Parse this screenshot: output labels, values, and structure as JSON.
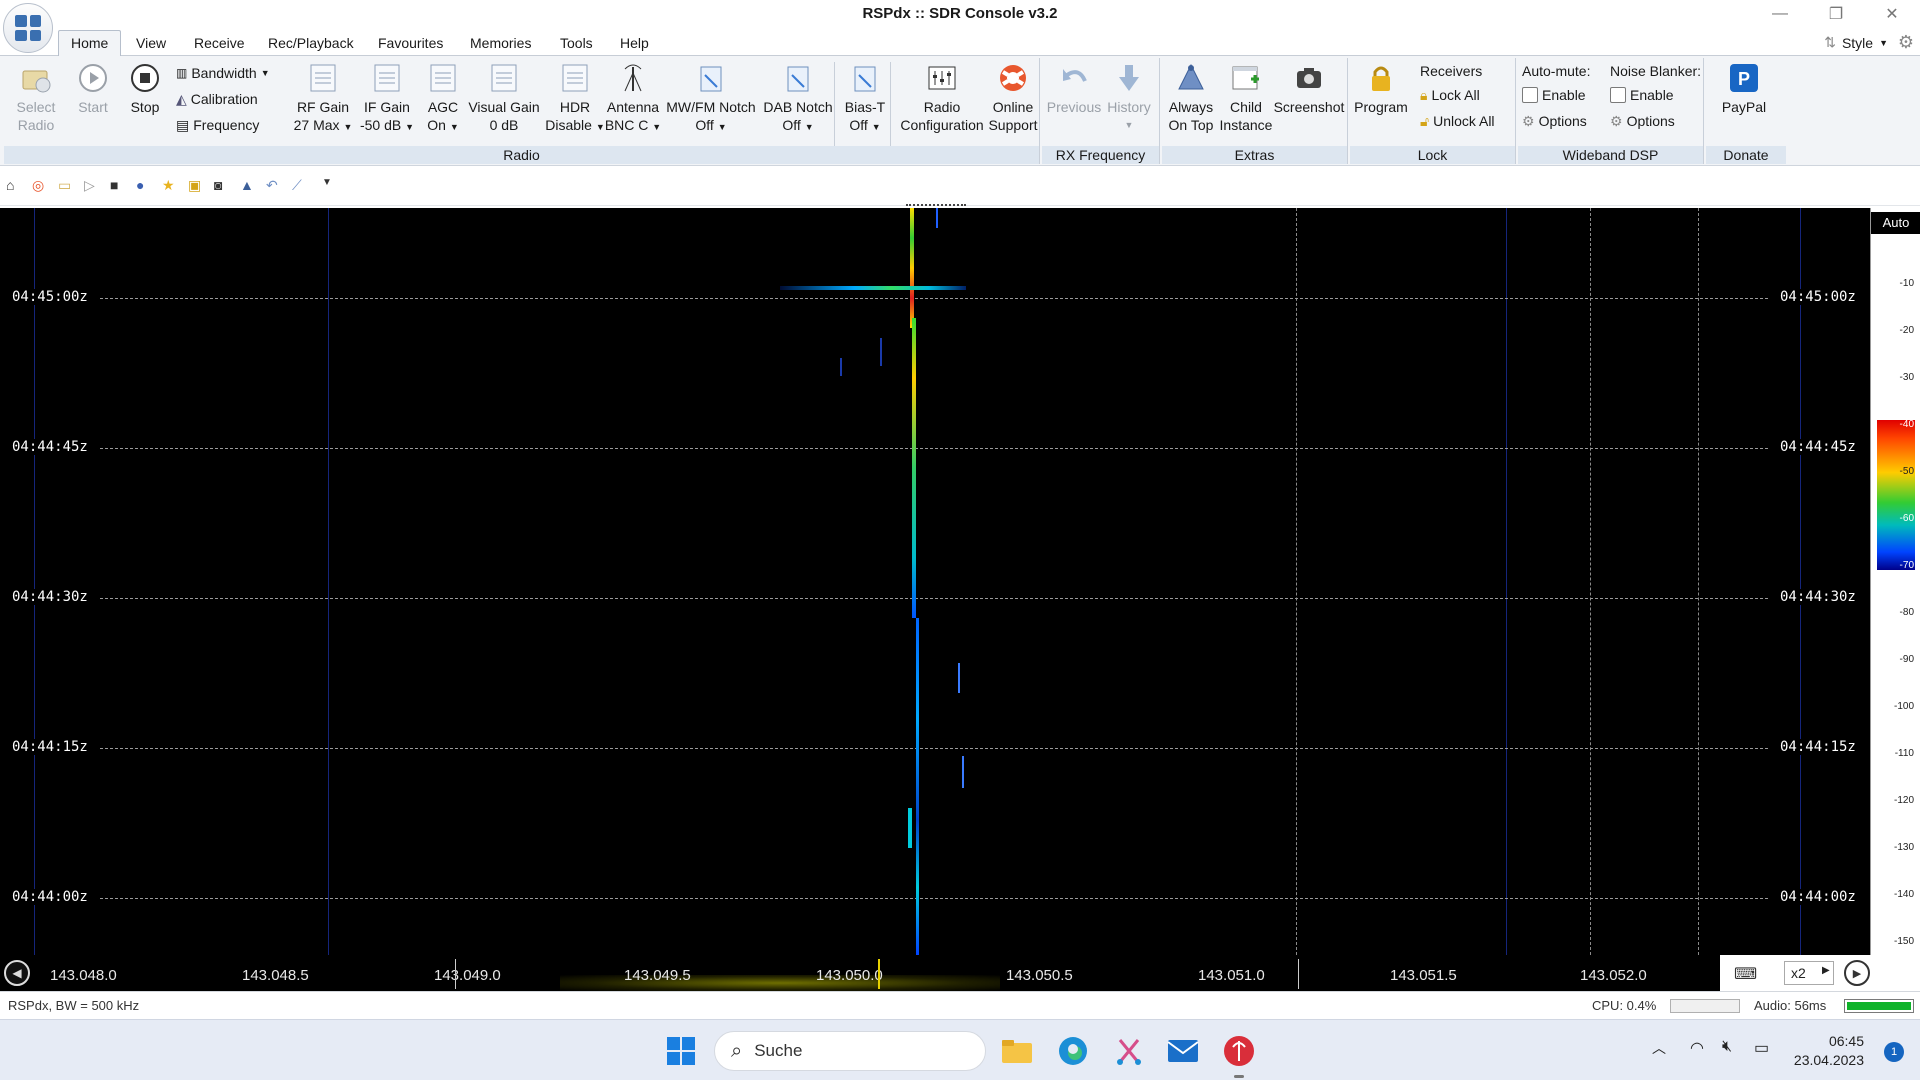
{
  "window": {
    "title": "RSPdx :: SDR Console v3.2"
  },
  "menu": {
    "tabs": [
      "Home",
      "View",
      "Receive",
      "Rec/Playback",
      "Favourites",
      "Memories",
      "Tools",
      "Help"
    ],
    "style_label": "Style"
  },
  "ribbon": {
    "radio": {
      "label": "Radio",
      "select_radio": [
        "Select",
        "Radio"
      ],
      "start": "Start",
      "stop": "Stop",
      "bandwidth": "Bandwidth",
      "calibration": "Calibration",
      "frequency": "Frequency",
      "rf_gain": [
        "RF Gain",
        "27 Max"
      ],
      "if_gain": [
        "IF Gain",
        "-50 dB"
      ],
      "agc": [
        "AGC",
        "On"
      ],
      "visual_gain": [
        "Visual Gain",
        "0 dB"
      ],
      "hdr": [
        "HDR",
        "Disable"
      ],
      "antenna": [
        "Antenna",
        "BNC C"
      ],
      "mwfm_notch": [
        "MW/FM Notch",
        "Off"
      ],
      "dab_notch": [
        "DAB Notch",
        "Off"
      ],
      "bias_t": [
        "Bias-T",
        "Off"
      ],
      "radio_config": [
        "Radio",
        "Configuration"
      ],
      "online_support": [
        "Online",
        "Support"
      ]
    },
    "rx_frequency": {
      "label": "RX Frequency",
      "previous": "Previous",
      "history": "History"
    },
    "extras": {
      "label": "Extras",
      "always_on_top": [
        "Always",
        "On Top"
      ],
      "child_instance": [
        "Child",
        "Instance"
      ],
      "screenshot": "Screenshot"
    },
    "lock": {
      "label": "Lock",
      "program": "Program",
      "receivers": "Receivers",
      "lock_all": "Lock All",
      "unlock_all": "Unlock All"
    },
    "wideband_dsp": {
      "label": "Wideband DSP",
      "auto_mute": "Auto-mute:",
      "noise_blanker": "Noise Blanker:",
      "enable": "Enable",
      "options": "Options"
    },
    "donate": {
      "label": "Donate",
      "paypal": "PayPal"
    }
  },
  "waterfall": {
    "time_labels": [
      "04:45:00z",
      "04:44:45z",
      "04:44:30z",
      "04:44:15z",
      "04:44:00z"
    ],
    "db_auto": "Auto",
    "db_ticks": [
      "-10",
      "-20",
      "-30",
      "-40",
      "-50",
      "-60",
      "-70",
      "-80",
      "-90",
      "-100",
      "-110",
      "-120",
      "-130",
      "-140",
      "-150"
    ]
  },
  "freq_axis": {
    "labels": [
      "143.048.0",
      "143.048.5",
      "143.049.0",
      "143.049.5",
      "143.050.0",
      "143.050.5",
      "143.051.0",
      "143.051.5",
      "143.052.0"
    ],
    "zoom": "x2"
  },
  "status": {
    "left": "RSPdx, BW = 500 kHz",
    "cpu": "CPU: 0.4%",
    "audio": "Audio: 56ms",
    "cpu_fill": 0.0,
    "audio_fill": 1.0
  },
  "taskbar": {
    "search_placeholder": "Suche",
    "time": "06:45",
    "date": "23.04.2023",
    "notifications": "1"
  },
  "colors": {
    "accent": "#3a6fb0",
    "signal_yellow": "#e6d000",
    "status_green": "#0fb32a"
  }
}
